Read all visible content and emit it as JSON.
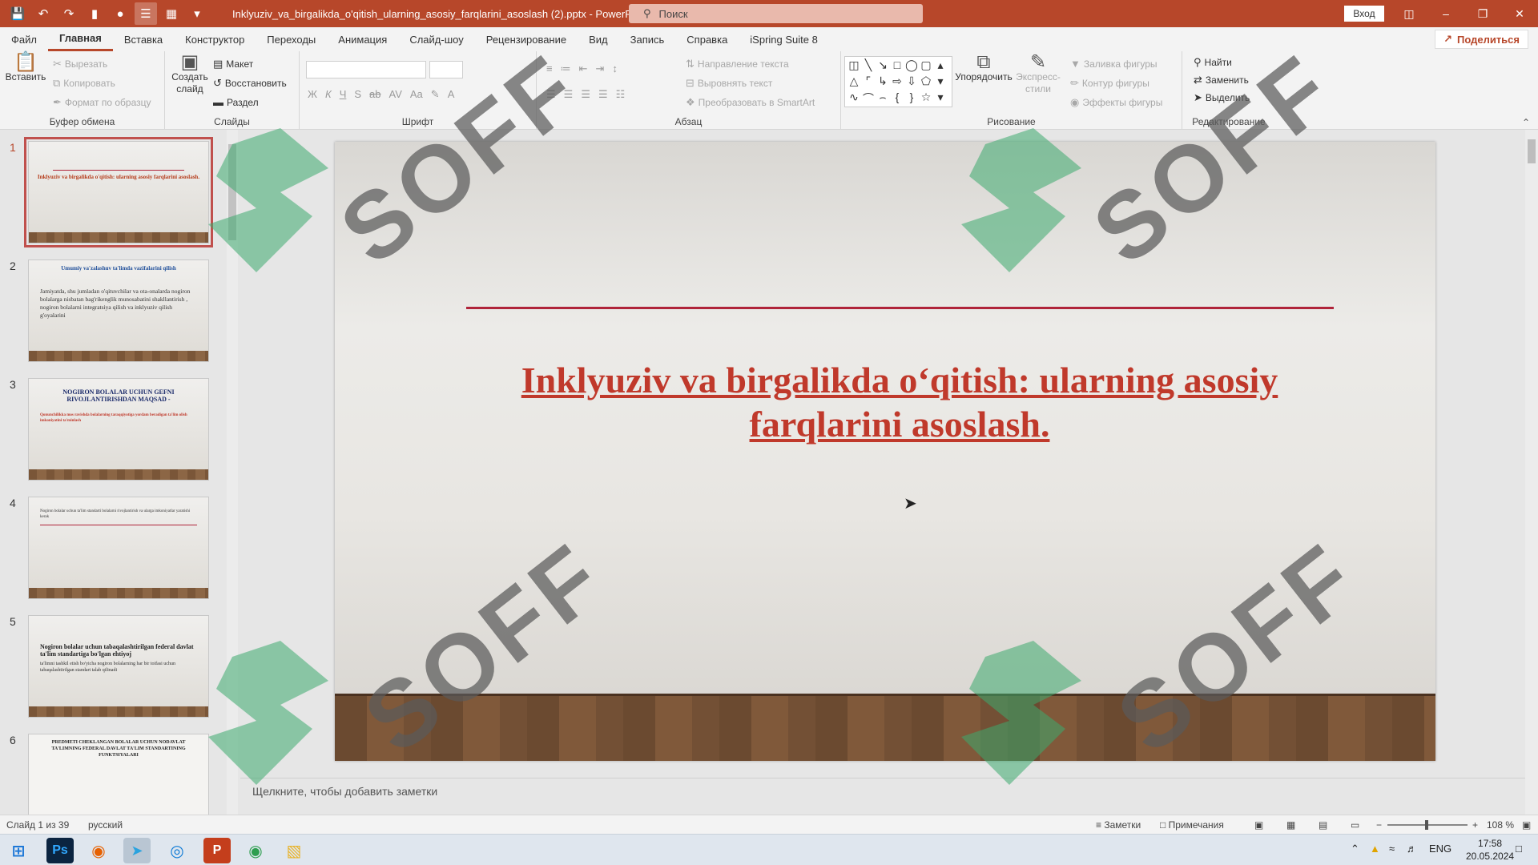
{
  "window": {
    "title": "Inklyuziv_va_birgalikda_o'qitish_ularning_asosiy_farqlarini_asoslash (2).pptx  -  PowerPoint",
    "search_placeholder": "Поиск",
    "login_label": "Вход"
  },
  "menu": {
    "tabs": [
      "Файл",
      "Главная",
      "Вставка",
      "Конструктор",
      "Переходы",
      "Анимация",
      "Слайд-шоу",
      "Рецензирование",
      "Вид",
      "Запись",
      "Справка",
      "iSpring Suite 8"
    ],
    "active": "Главная",
    "share_label": "Поделиться"
  },
  "ribbon": {
    "clipboard": {
      "label": "Буфер обмена",
      "paste": "Вставить",
      "cut": "Вырезать",
      "copy": "Копировать",
      "format_painter": "Формат по образцу"
    },
    "slides": {
      "label": "Слайды",
      "new_slide_1": "Создать",
      "new_slide_2": "слайд",
      "layout": "Макет",
      "reset": "Восстановить",
      "section": "Раздел"
    },
    "font": {
      "label": "Шрифт"
    },
    "paragraph": {
      "label": "Абзац",
      "text_direction": "Направление текста",
      "align_text": "Выровнять текст",
      "convert_smartart": "Преобразовать в SmartArt"
    },
    "drawing": {
      "label": "Рисование",
      "arrange": "Упорядочить",
      "quick_styles_1": "Экспресс-",
      "quick_styles_2": "стили",
      "shape_fill": "Заливка фигуры",
      "shape_outline": "Контур фигуры",
      "shape_effects": "Эффекты фигуры"
    },
    "editing": {
      "label": "Редактирование",
      "find": "Найти",
      "replace": "Заменить",
      "select": "Выделить"
    }
  },
  "thumbnails": [
    {
      "num": "1",
      "title": "Inklyuziv va birgalikda o'qitish: ularning asosiy farqlarini asoslash."
    },
    {
      "num": "2",
      "head": "Umumiy va'zalashuv ta'limda vazifalarini qilish",
      "text": "Jamiyatda, shu jumladan o'qituvchilar va ota-onalarda nogiron bolalarga nisbatan bag'rikenglik munosabatini shakllantirish , nogiron bolalarni integratsiya qilish va inklyuziv qilish g'oyalarini"
    },
    {
      "num": "3",
      "head": "NOGIRON BOLALAR UCHUN GEFNI RIVOJLANTIRISHDAN MAQSAD -",
      "text": "Qonunchilikka mos ravishda bolalarning taraqqiyotiga yordam beradigan ta'lim olish imkoniyatini ta'minlash"
    },
    {
      "num": "4",
      "text": "Nogiron bolalar uchun ta'lim standarti bolalarni rivojlantirish va ularga imkoniyatlar yaratishi kerak"
    },
    {
      "num": "5",
      "head": "Nogiron bolalar uchun tabaqalashtirilgan federal davlat ta'lim standartiga bo'lgan ehtiyoj",
      "text": "ta'limni tashkil etish bo'yicha nogiron bolalarning har bir toifasi uchun tabaqalashtirilgan standart talab qilinadi"
    },
    {
      "num": "6",
      "head": "PREDMETI CHEKLANGAN BOLALAR UCHUN NODAVLAT TA'LIMNING FEDERAL DAVLAT TA'LIM STANDARTINING FUNKTSIYALARI"
    }
  ],
  "slide": {
    "title_line1": "Inklyuziv va birgalikda o‘qitish: ularning asosiy",
    "title_line2": "farqlarini asoslash."
  },
  "notes_placeholder": "Щелкните, чтобы добавить заметки",
  "status": {
    "slide_info": "Слайд 1 из 39",
    "language": "русский",
    "notes": "Заметки",
    "comments": "Примечания",
    "zoom": "108 %"
  },
  "taskbar": {
    "lang": "ENG",
    "time": "17:58",
    "date": "20.05.2024"
  },
  "watermark": "SOFF",
  "colors": {
    "accent": "#b7472a",
    "title_red": "#c0392b",
    "rule": "#b0243a"
  }
}
